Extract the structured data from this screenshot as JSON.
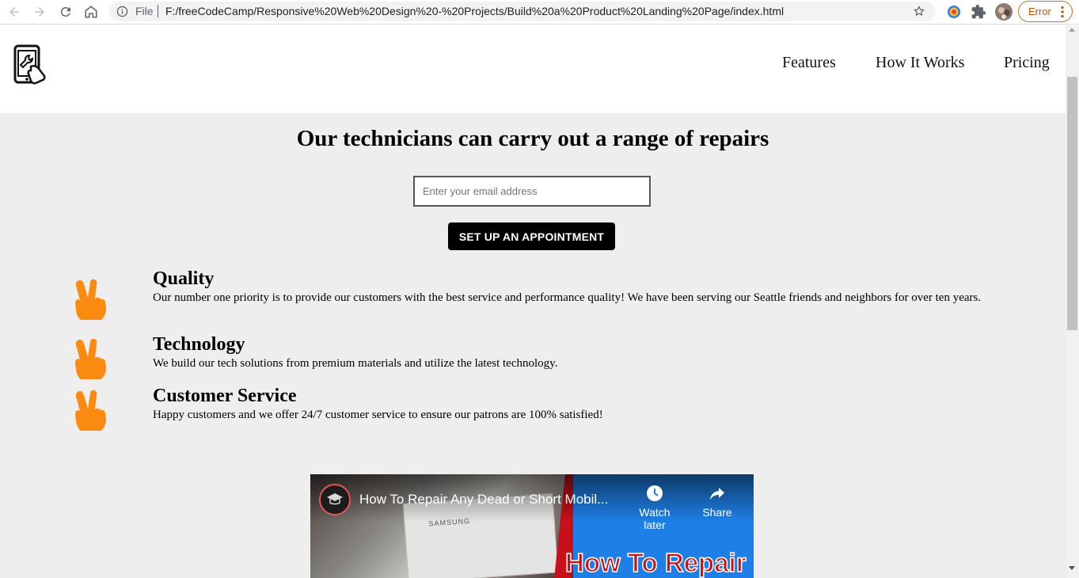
{
  "browser": {
    "file_label": "File",
    "url": "F:/freeCodeCamp/Responsive%20Web%20Design%20-%20Projects/Build%20a%20Product%20Landing%20Page/index.html",
    "error_label": "Error"
  },
  "nav": {
    "links": [
      "Features",
      "How It Works",
      "Pricing"
    ]
  },
  "hero": {
    "title": "Our technicians can carry out a range of repairs",
    "email_placeholder": "Enter your email address",
    "button_label": "SET UP AN APPOINTMENT"
  },
  "features": [
    {
      "title": "Quality",
      "description": "Our number one priority is to provide our customers with the best service and performance quality! We have been serving our Seattle friends and neighbors for over ten years."
    },
    {
      "title": "Technology",
      "description": "We build our tech solutions from premium materials and utilize the latest technology."
    },
    {
      "title": "Customer Service",
      "description": "Happy customers and we offer 24/7 customer service to ensure our patrons are 100% satisfied!"
    }
  ],
  "video": {
    "title": "How To Repair Any Dead or Short Mobil...",
    "watch_later_label": "Watch later",
    "share_label": "Share",
    "thumbnail_text": "How To Repair",
    "card_text": "SAMSUNG"
  },
  "colors": {
    "icon_orange": "#fb8b10",
    "page_bg": "#eeeeee",
    "button_bg": "#000000"
  }
}
